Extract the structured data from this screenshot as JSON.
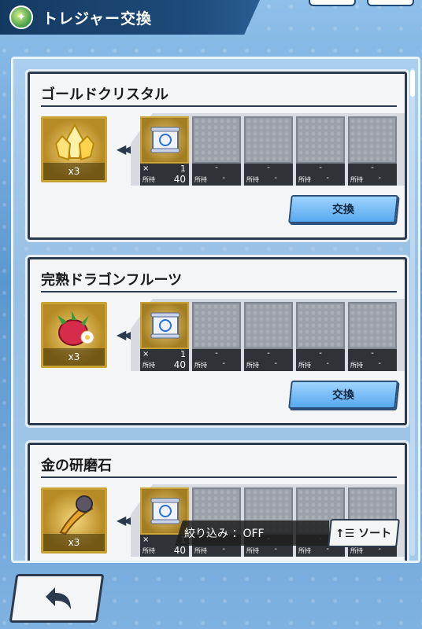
{
  "header": {
    "title": "トレジャー交換"
  },
  "cards": [
    {
      "name": "ゴールドクリスタル",
      "reward_qty": "x3",
      "reward_icon": "gold-crystal-icon",
      "cost": {
        "mult_label": "×",
        "amount": "1",
        "owned_label": "所持",
        "owned": "40"
      },
      "empty_slot_text": {
        "top": "-",
        "owned_label": "所持",
        "owned": "-"
      },
      "button": "交換"
    },
    {
      "name": "完熟ドラゴンフルーツ",
      "reward_qty": "x3",
      "reward_icon": "dragon-fruit-icon",
      "cost": {
        "mult_label": "×",
        "amount": "1",
        "owned_label": "所持",
        "owned": "40"
      },
      "empty_slot_text": {
        "top": "-",
        "owned_label": "所持",
        "owned": "-"
      },
      "button": "交換"
    },
    {
      "name": "金の研磨石",
      "reward_qty": "x3",
      "reward_icon": "whetstone-icon",
      "cost": {
        "mult_label": "×",
        "amount": "1",
        "owned_label": "所持",
        "owned": "40"
      },
      "empty_slot_text": {
        "top": "-",
        "owned_label": "所持",
        "owned": "-"
      },
      "button": "交換"
    }
  ],
  "filter": {
    "label": "絞り込み ：OFF"
  },
  "sort": {
    "label": "ソート"
  },
  "colors": {
    "accent": "#57a9ee",
    "header": "#1d4a78",
    "gold": "#c9a234"
  }
}
